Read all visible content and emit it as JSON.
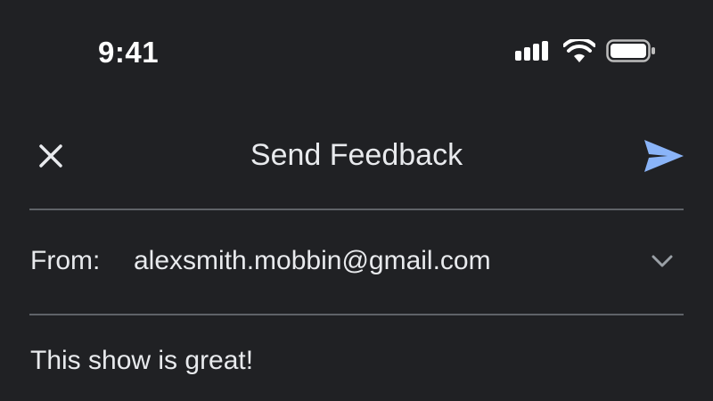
{
  "status_bar": {
    "time": "9:41"
  },
  "header": {
    "title": "Send Feedback",
    "close_icon": "close-icon",
    "send_icon": "send-icon"
  },
  "from_row": {
    "label": "From:",
    "value": "alexsmith.mobbin@gmail.com",
    "dropdown_icon": "chevron-down-icon"
  },
  "message": {
    "text": "This show is great!"
  },
  "colors": {
    "background": "#202124",
    "accent": "#8ab4f8",
    "divider": "#5f6368"
  }
}
